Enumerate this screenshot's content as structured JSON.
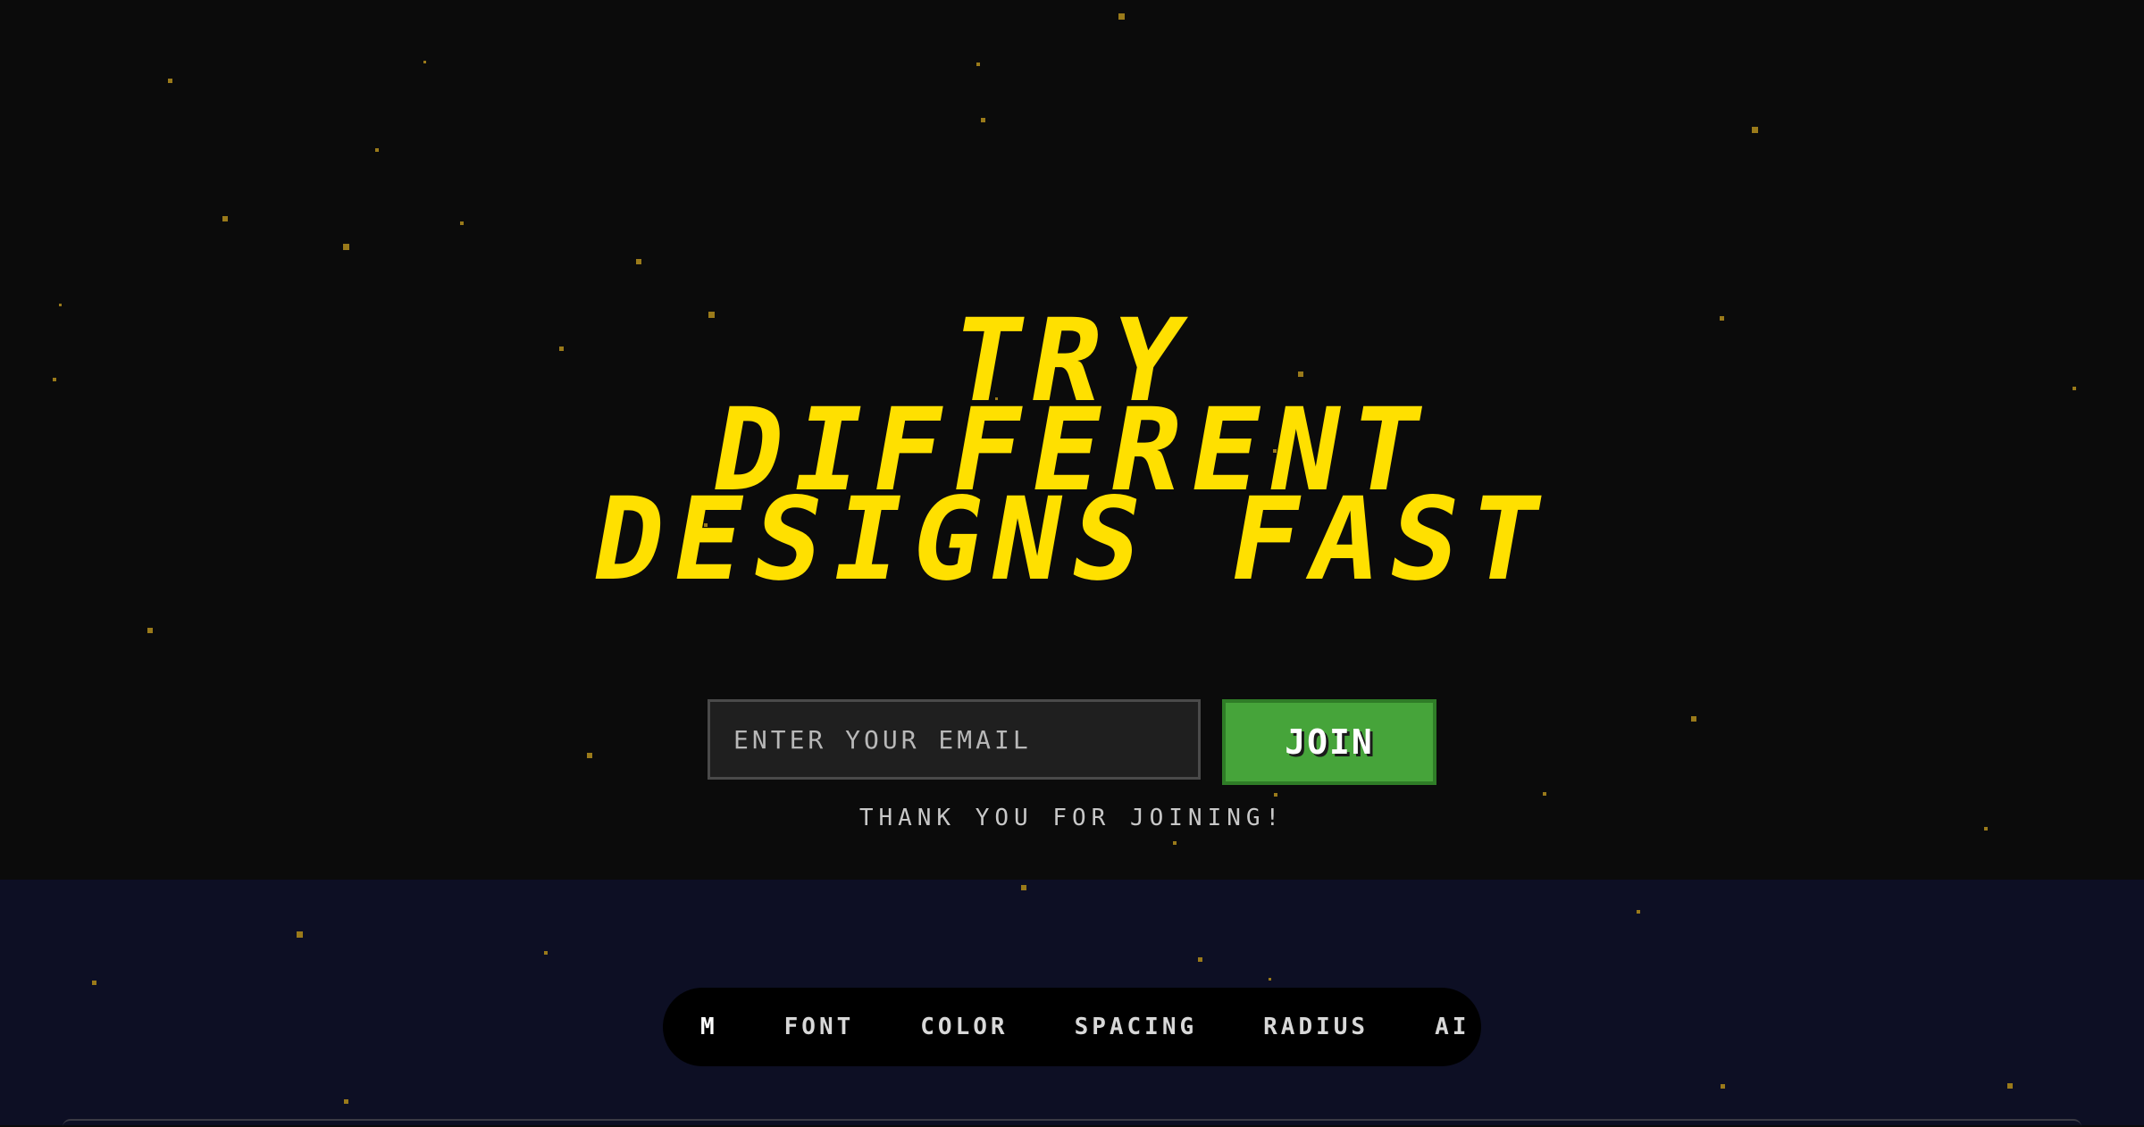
{
  "hero": {
    "headline_lines": [
      "TRY",
      "DIFFERENT",
      "DESIGNS FAST"
    ],
    "accent_color": "#ffe000"
  },
  "signup": {
    "email_placeholder": "ENTER YOUR EMAIL",
    "join_label": "JOIN",
    "join_color": "#46a43a",
    "thanks_message": "THANK YOU FOR JOINING!"
  },
  "nav": {
    "brand": "M",
    "items": [
      "FONT",
      "COLOR",
      "SPACING",
      "RADIUS",
      "AI"
    ]
  }
}
